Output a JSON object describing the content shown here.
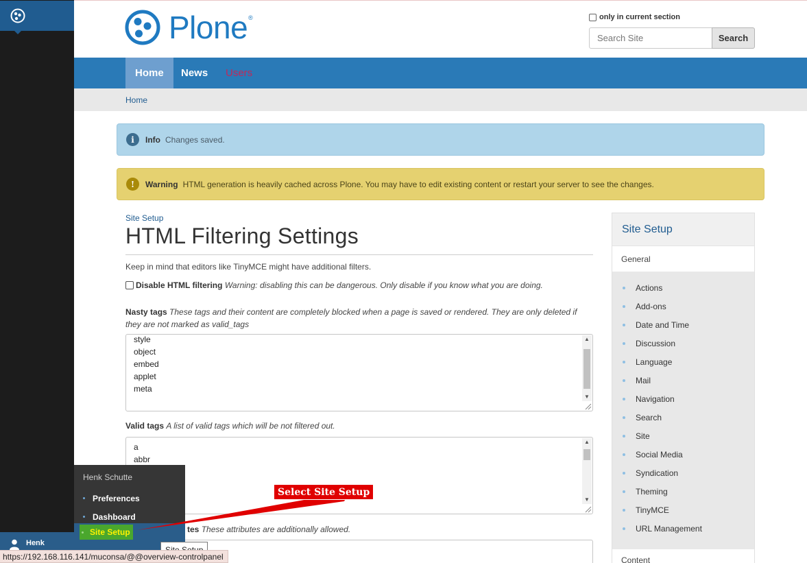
{
  "toolbar": {
    "user_first": "Henk"
  },
  "header": {
    "logo_text": "Plone",
    "logo_reg": "®",
    "search_option_label": "only in current section",
    "search_placeholder": "Search Site",
    "search_button": "Search"
  },
  "nav": {
    "items": [
      {
        "label": "Home",
        "active": true
      },
      {
        "label": "News"
      },
      {
        "label": "Users"
      }
    ]
  },
  "breadcrumbs": {
    "home": "Home"
  },
  "alerts": {
    "info": {
      "icon": "i",
      "title": "Info",
      "message": "Changes saved."
    },
    "warning": {
      "icon": "!",
      "title": "Warning",
      "message": "HTML generation is heavily cached across Plone. You may have to edit existing content or restart your server to see the changes."
    }
  },
  "main": {
    "parent_link": "Site Setup",
    "title": "HTML Filtering Settings",
    "intro": "Keep in mind that editors like TinyMCE might have additional filters.",
    "disable_filtering": {
      "label": "Disable HTML filtering",
      "help": "Warning: disabling this can be dangerous. Only disable if you know what you are doing."
    },
    "nasty_tags": {
      "label": "Nasty tags",
      "help": "These tags and their content are completely blocked when a page is saved or rendered. They are only deleted if they are not marked as valid_tags",
      "lines": [
        "style",
        "object",
        "embed",
        "applet",
        "meta"
      ]
    },
    "valid_tags": {
      "label": "Valid tags",
      "help": "A list of valid tags which will be not filtered out.",
      "lines": [
        "a",
        "abbr"
      ]
    },
    "custom_attributes": {
      "label_partial": "tes",
      "help": "These attributes are additionally allowed."
    }
  },
  "portlet": {
    "title": "Site Setup",
    "general": "General",
    "items": [
      "Actions",
      "Add-ons",
      "Date and Time",
      "Discussion",
      "Language",
      "Mail",
      "Navigation",
      "Search",
      "Site",
      "Social Media",
      "Syndication",
      "Theming",
      "TinyMCE",
      "URL Management"
    ],
    "content": "Content"
  },
  "user_menu": {
    "name": "Henk Schutte",
    "items": [
      "Preferences",
      "Dashboard"
    ],
    "highlighted": "Site Setup"
  },
  "annotation": {
    "text": "Select Site Setup"
  },
  "tooltip": {
    "text": "Site Setup"
  },
  "status_bar": {
    "url": "https://192.168.116.141/muconsa/@@overview-controlpanel"
  },
  "colors": {
    "brand_blue": "#1f7ac1",
    "nav_bar": "#2a7ab7",
    "info_bg": "#afd5ea",
    "warning_bg": "#e5d170",
    "callout_red": "#e00000",
    "highlight_green": "#4aa72d"
  }
}
